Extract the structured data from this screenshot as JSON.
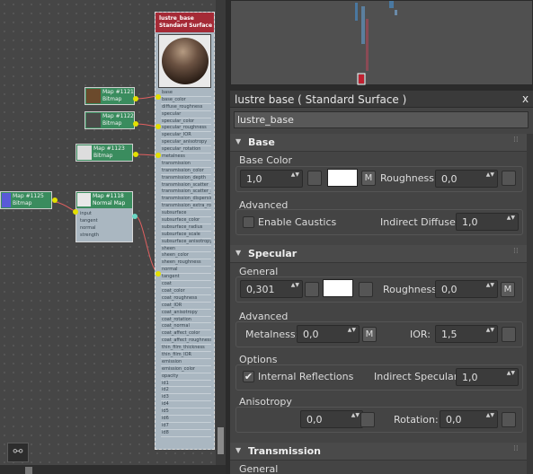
{
  "node_editor": {
    "nodes": [
      {
        "id": "map1121",
        "title": "Map #1121",
        "subtitle": "Bitmap"
      },
      {
        "id": "map1122",
        "title": "Map #1122",
        "subtitle": "Bitmap"
      },
      {
        "id": "map1123",
        "title": "Map #1123",
        "subtitle": "Bitmap"
      },
      {
        "id": "map1125",
        "title": "Map #1125",
        "subtitle": "Bitmap"
      }
    ],
    "normal_map": {
      "title": "Map #1118",
      "subtitle": "Normal Map",
      "ports": [
        "input",
        "tangent",
        "normal",
        "strength"
      ]
    },
    "standard_surface": {
      "title": "lustre_base",
      "subtitle": "Standard Surface",
      "ports": [
        "base",
        "base_color",
        "diffuse_roughness",
        "specular",
        "specular_color",
        "specular_roughness",
        "specular_IOR",
        "specular_anisotropy",
        "specular_rotation",
        "metalness",
        "transmission",
        "transmission_color",
        "transmission_depth",
        "transmission_scatter",
        "transmission_scatter_ani",
        "transmission_dispersion",
        "transmission_extra_roug",
        "subsurface",
        "subsurface_color",
        "subsurface_radius",
        "subsurface_scale",
        "subsurface_anisotropy",
        "sheen",
        "sheen_color",
        "sheen_roughness",
        "normal",
        "tangent",
        "coat",
        "coat_color",
        "coat_roughness",
        "coat_IOR",
        "coat_anisotropy",
        "coat_rotation",
        "coat_normal",
        "coat_affect_color",
        "coat_affect_roughness",
        "thin_film_thickness",
        "thin_film_IOR",
        "emission",
        "emission_color",
        "opacity",
        "id1",
        "id2",
        "id3",
        "id4",
        "id5",
        "id6",
        "id7",
        "id8"
      ]
    },
    "nav_icon": "binoculars-icon"
  },
  "panel": {
    "title": "lustre base  ( Standard Surface )",
    "close": "x",
    "material_name": "lustre_base",
    "sections": {
      "base": {
        "label": "Base",
        "arrow": "▼"
      },
      "specular": {
        "label": "Specular",
        "arrow": "▼"
      },
      "transmission": {
        "label": "Transmission",
        "arrow": "▼"
      }
    },
    "base": {
      "group_color": "Base Color",
      "weight": "1,0",
      "roughness_label": "Roughness:",
      "roughness": "0,0",
      "group_advanced": "Advanced",
      "caustics_label": "Enable Caustics",
      "indirect_diffuse_label": "Indirect Diffuse:",
      "indirect_diffuse": "1,0"
    },
    "specular": {
      "group_general": "General",
      "weight": "0,301",
      "roughness_label": "Roughness:",
      "roughness": "0,0",
      "group_advanced": "Advanced",
      "metalness_label": "Metalness:",
      "metalness": "0,0",
      "ior_label": "IOR:",
      "ior": "1,5",
      "group_options": "Options",
      "internal_reflections_label": "Internal Reflections",
      "internal_reflections_check": "✔",
      "indirect_specular_label": "Indirect Specular:",
      "indirect_specular": "1,0",
      "group_anisotropy": "Anisotropy",
      "anisotropy": "0,0",
      "rotation_label": "Rotation:",
      "rotation": "0,0"
    },
    "transmission": {
      "group_general": "General"
    },
    "m_label": "M",
    "spin_arrows": "▲▼",
    "colors": {
      "swatch": "#ffffff",
      "node_header": "#a52a36",
      "map_node": "#3a8c5e",
      "port": "#e3e000"
    }
  }
}
